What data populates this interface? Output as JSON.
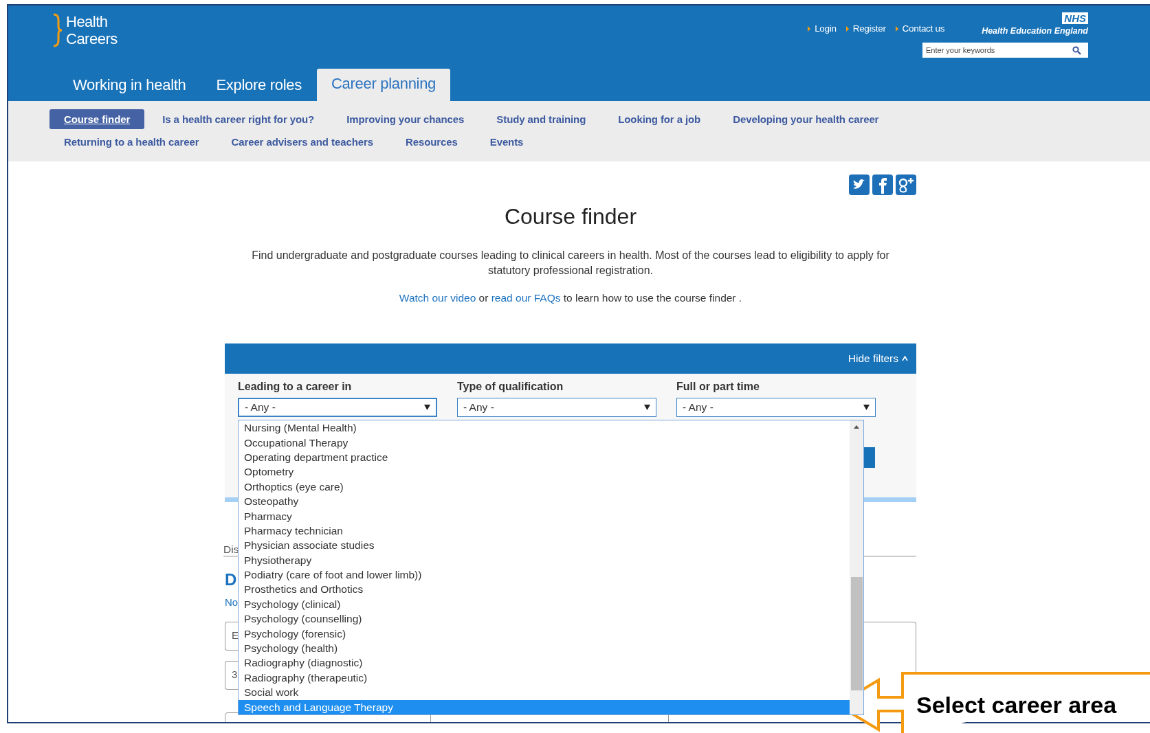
{
  "header": {
    "logo_lines": [
      "Health",
      "Careers"
    ],
    "top_links": [
      "Login",
      "Register",
      "Contact us"
    ],
    "org": {
      "badge": "NHS",
      "name": "Health Education England"
    },
    "search": {
      "placeholder": "Enter your keywords"
    }
  },
  "main_tabs": [
    {
      "label": "Working in health",
      "selected": false
    },
    {
      "label": "Explore roles",
      "selected": false
    },
    {
      "label": "Career planning",
      "selected": true
    }
  ],
  "sub_nav": [
    {
      "items": [
        {
          "label": "Course finder",
          "selected": true
        },
        {
          "label": "Is a health career right for you?",
          "selected": false
        },
        {
          "label": "Improving your chances",
          "selected": false
        },
        {
          "label": "Study and training",
          "selected": false
        },
        {
          "label": "Looking for a job",
          "selected": false
        },
        {
          "label": "Developing your health career",
          "selected": false
        }
      ]
    },
    {
      "items": [
        {
          "label": "Returning to a health career",
          "selected": false
        },
        {
          "label": "Career advisers and teachers",
          "selected": false
        },
        {
          "label": "Resources",
          "selected": false
        },
        {
          "label": "Events",
          "selected": false
        }
      ]
    }
  ],
  "page": {
    "title": "Course finder",
    "intro": "Find undergraduate and postgraduate courses leading to clinical careers in health. Most of the courses lead to eligibility to apply for statutory professional registration.",
    "help": [
      {
        "kind": "link",
        "text": "Watch our video"
      },
      {
        "kind": "text",
        "text": "or"
      },
      {
        "kind": "link",
        "text": "read our FAQs"
      },
      {
        "kind": "text",
        "text": "to learn how to use the course finder ."
      }
    ]
  },
  "filters": {
    "toggle": "Hide filters",
    "fields": [
      {
        "label": "Leading to a career in",
        "value": "- Any -",
        "open": true
      },
      {
        "label": "Type of qualification",
        "value": "- Any -",
        "open": false
      },
      {
        "label": "Full or part time",
        "value": "- Any -",
        "open": false
      }
    ],
    "options": [
      {
        "label": "Nursing (Mental Health)",
        "selected": false
      },
      {
        "label": "Occupational Therapy",
        "selected": false
      },
      {
        "label": "Operating department practice",
        "selected": false
      },
      {
        "label": "Optometry",
        "selected": false
      },
      {
        "label": "Orthoptics (eye care)",
        "selected": false
      },
      {
        "label": "Osteopathy",
        "selected": false
      },
      {
        "label": "Pharmacy",
        "selected": false
      },
      {
        "label": "Pharmacy technician",
        "selected": false
      },
      {
        "label": "Physician associate studies",
        "selected": false
      },
      {
        "label": "Physiotherapy",
        "selected": false
      },
      {
        "label": "Podiatry (care of foot and lower limb))",
        "selected": false
      },
      {
        "label": "Prosthetics and Orthotics",
        "selected": false
      },
      {
        "label": "Psychology (clinical)",
        "selected": false
      },
      {
        "label": "Psychology (counselling)",
        "selected": false
      },
      {
        "label": "Psychology (forensic)",
        "selected": false
      },
      {
        "label": "Psychology (health)",
        "selected": false
      },
      {
        "label": "Radiography (diagnostic)",
        "selected": false
      },
      {
        "label": "Radiography (therapeutic)",
        "selected": false
      },
      {
        "label": "Social work",
        "selected": false
      },
      {
        "label": "Speech and Language Therapy",
        "selected": true
      }
    ]
  },
  "results": {
    "distance_label": "Dis",
    "heading": "D",
    "note": "No",
    "inputs": [
      "E",
      "3"
    ]
  },
  "callout": {
    "text": "Select career area"
  }
}
